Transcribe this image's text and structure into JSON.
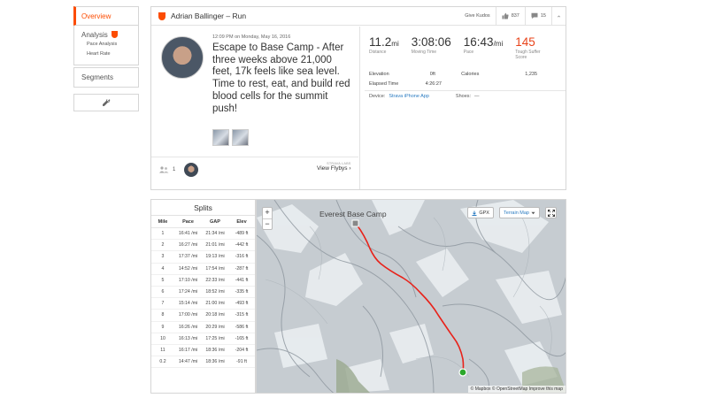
{
  "nav": {
    "overview": "Overview",
    "analysis": "Analysis",
    "analysis_sub": [
      "Pace Analysis",
      "Heart Rate"
    ],
    "segments": "Segments",
    "tool_icon": "wrench-icon"
  },
  "header": {
    "title": "Adrian Ballinger – Run",
    "give_kudos": "Give Kudos",
    "kudos_count": "837",
    "comments_count": "15"
  },
  "activity": {
    "datetime": "12:09 PM on Monday, May 16, 2016",
    "description": "Escape to Base Camp - After three weeks above 21,000 feet, 17k feels like sea level. Time to rest, eat, and build red blood cells for the summit push!",
    "athletes_count": "1",
    "flyby_top": "STRAVA LABS",
    "flyby_link": "View Flybys"
  },
  "stats": {
    "distance": {
      "value": "11.2",
      "unit": "mi",
      "label": "Distance"
    },
    "moving_time": {
      "value": "3:08:06",
      "label": "Moving Time"
    },
    "pace": {
      "value": "16:43",
      "unit": "/mi",
      "label": "Pace"
    },
    "suffer": {
      "value": "145",
      "label": "Tough Suffer Score"
    },
    "elevation_label": "Elevation",
    "elevation_value": "0ft",
    "calories_label": "Calories",
    "calories_value": "1,235",
    "elapsed_label": "Elapsed Time",
    "elapsed_value": "4:26:27",
    "device_label": "Device:",
    "device_value": "Strava iPhone App",
    "shoes_label": "Shoes:",
    "shoes_value": "—"
  },
  "splits": {
    "title": "Splits",
    "headers": [
      "Mile",
      "Pace",
      "GAP",
      "Elev"
    ],
    "rows": [
      [
        "1",
        "16:41 /mi",
        "21:34 /mi",
        "-489 ft"
      ],
      [
        "2",
        "16:27 /mi",
        "21:01 /mi",
        "-442 ft"
      ],
      [
        "3",
        "17:37 /mi",
        "19:13 /mi",
        "-316 ft"
      ],
      [
        "4",
        "14:52 /mi",
        "17:54 /mi",
        "-287 ft"
      ],
      [
        "5",
        "17:10 /mi",
        "22:33 /mi",
        "-441 ft"
      ],
      [
        "6",
        "17:24 /mi",
        "18:52 /mi",
        "-335 ft"
      ],
      [
        "7",
        "15:14 /mi",
        "21:00 /mi",
        "-493 ft"
      ],
      [
        "8",
        "17:00 /mi",
        "20:18 /mi",
        "-315 ft"
      ],
      [
        "9",
        "16:26 /mi",
        "20:29 /mi",
        "-586 ft"
      ],
      [
        "10",
        "16:13 /mi",
        "17:25 /mi",
        "-165 ft"
      ],
      [
        "11",
        "16:17 /mi",
        "18:36 /mi",
        "-204 ft"
      ],
      [
        "0.2",
        "14:47 /mi",
        "18:36 /mi",
        "-91 ft"
      ]
    ]
  },
  "map": {
    "label": "Everest Base Camp",
    "zoom_in": "+",
    "zoom_out": "−",
    "gpx_label": "GPX",
    "terrain_label": "Terrain Map",
    "attribution": "© Mapbox © OpenStreetMap Improve this map",
    "route_color": "#e8221a",
    "end_color": "#2ba82b"
  },
  "colors": {
    "brand": "#fc4c02",
    "link": "#2a7bc1"
  }
}
